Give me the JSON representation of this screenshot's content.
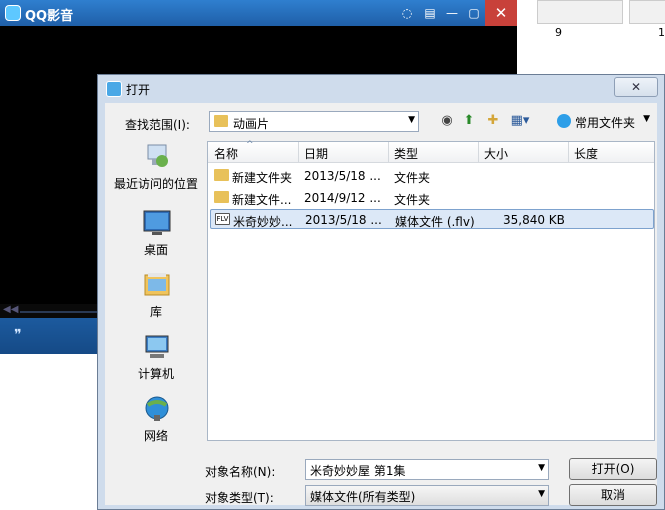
{
  "player": {
    "title": "QQ影音",
    "ctrl_icon": "footprint-icon"
  },
  "thumbnails": [
    {
      "number": "9"
    },
    {
      "number": "1"
    }
  ],
  "dialog": {
    "title": "打开",
    "close_glyph": "✕",
    "look_in_label": "查找范围(I):",
    "look_in_value": "动画片",
    "places_button": "常用文件夹",
    "places": [
      {
        "label": "最近访问的位置",
        "icon": "recent-places-icon"
      },
      {
        "label": "桌面",
        "icon": "desktop-icon"
      },
      {
        "label": "库",
        "icon": "libraries-icon"
      },
      {
        "label": "计算机",
        "icon": "computer-icon"
      },
      {
        "label": "网络",
        "icon": "network-icon"
      }
    ],
    "columns": [
      "名称",
      "日期",
      "类型",
      "大小",
      "长度"
    ],
    "files": [
      {
        "name": "新建文件夹",
        "date": "2013/5/18 ...",
        "type": "文件夹",
        "size": "",
        "selected": false,
        "icon": "folder-icon"
      },
      {
        "name": "新建文件...",
        "date": "2014/9/12 ...",
        "type": "文件夹",
        "size": "",
        "selected": false,
        "icon": "folder-icon"
      },
      {
        "name": "米奇妙妙...",
        "date": "2013/5/18 ...",
        "type": "媒体文件 (.flv)",
        "size": "35,840 KB",
        "selected": true,
        "icon": "flv-file-icon"
      }
    ],
    "object_name_label": "对象名称(N):",
    "object_name_value": "米奇妙妙屋 第1集",
    "object_type_label": "对象类型(T):",
    "object_type_value": "媒体文件(所有类型)",
    "open_button": "打开(O)",
    "cancel_button": "取消"
  }
}
